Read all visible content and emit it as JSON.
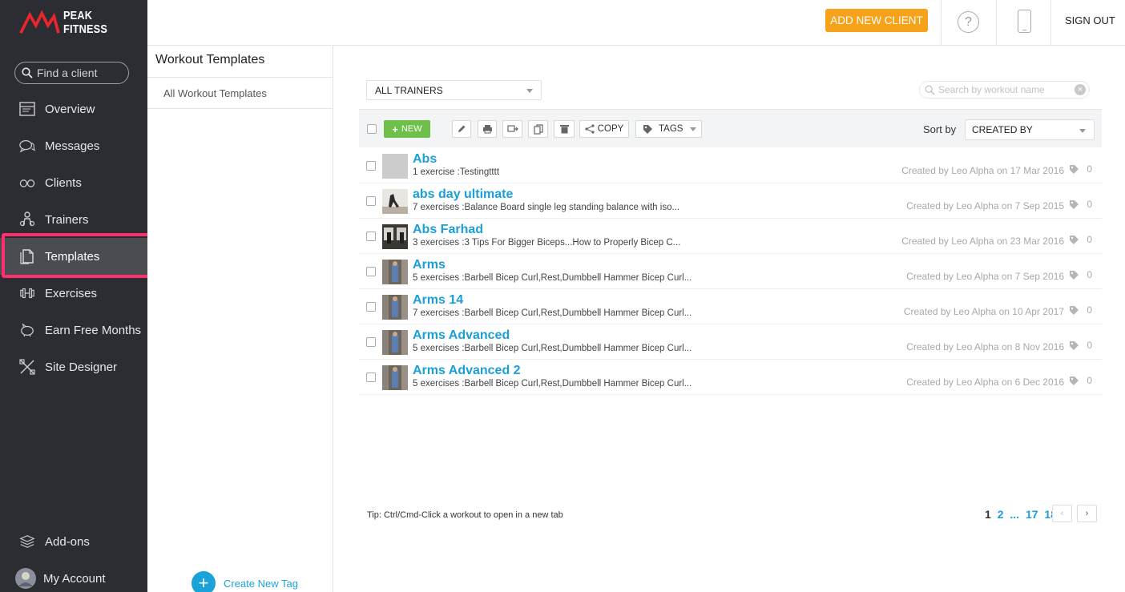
{
  "brand": {
    "name": "PEAK FITNESS",
    "accent": "#f7a21b",
    "link_color": "#1a9fd8"
  },
  "sidebar": {
    "search_placeholder": "Find a client",
    "items": [
      {
        "label": "Overview",
        "icon": "overview-icon"
      },
      {
        "label": "Messages",
        "icon": "messages-icon"
      },
      {
        "label": "Clients",
        "icon": "clients-icon"
      },
      {
        "label": "Trainers",
        "icon": "trainers-icon"
      },
      {
        "label": "Templates",
        "icon": "templates-icon",
        "active": true
      },
      {
        "label": "Exercises",
        "icon": "dumbbell-icon"
      },
      {
        "label": "Earn Free Months",
        "icon": "piggy-bank-icon"
      },
      {
        "label": "Site Designer",
        "icon": "site-designer-icon"
      }
    ],
    "bottom": [
      {
        "label": "Add-ons",
        "icon": "layers-icon"
      },
      {
        "label": "My Account",
        "icon": "avatar"
      }
    ]
  },
  "panel": {
    "title": "Workout Templates",
    "item": "All Workout Templates",
    "create_tag": "Create New Tag"
  },
  "topbar": {
    "add_client": "ADD NEW CLIENT",
    "help": "?",
    "sign_out": "SIGN OUT"
  },
  "filters": {
    "trainer": "ALL TRAINERS",
    "search_placeholder": "Search by workout name"
  },
  "toolbar": {
    "new": "NEW",
    "copy": "COPY",
    "tags": "TAGS",
    "sort_label": "Sort by",
    "sort_value": "CREATED BY"
  },
  "workouts": [
    {
      "title": "Abs",
      "desc": "1 exercise :Testingtttt",
      "meta": "Created by Leo Alpha on 17 Mar 2016",
      "tags": "0"
    },
    {
      "title": "abs day ultimate",
      "desc": "7 exercises :Balance Board single leg standing balance with iso...",
      "meta": "Created by Leo Alpha on 7 Sep 2015",
      "tags": "0"
    },
    {
      "title": "Abs Farhad",
      "desc": "3 exercises :3 Tips For Bigger Biceps...How to Properly Bicep C...",
      "meta": "Created by Leo Alpha on 23 Mar 2016",
      "tags": "0"
    },
    {
      "title": "Arms",
      "desc": "5 exercises :Barbell Bicep Curl,Rest,Dumbbell Hammer Bicep Curl...",
      "meta": "Created by Leo Alpha on 7 Sep 2016",
      "tags": "0"
    },
    {
      "title": "Arms 14",
      "desc": "7 exercises :Barbell Bicep Curl,Rest,Dumbbell Hammer Bicep Curl...",
      "meta": "Created by Leo Alpha on 10 Apr 2017",
      "tags": "0"
    },
    {
      "title": "Arms Advanced",
      "desc": "5 exercises :Barbell Bicep Curl,Rest,Dumbbell Hammer Bicep Curl...",
      "meta": "Created by Leo Alpha on 8 Nov 2016",
      "tags": "0"
    },
    {
      "title": "Arms Advanced 2",
      "desc": "5 exercises :Barbell Bicep Curl,Rest,Dumbbell Hammer Bicep Curl...",
      "meta": "Created by Leo Alpha on 6 Dec 2016",
      "tags": "0"
    }
  ],
  "footer": {
    "tip": "Tip: Ctrl/Cmd-Click a workout to open in a new tab",
    "pages": [
      "1",
      "2",
      "...",
      "17",
      "18"
    ],
    "current_page": "1"
  }
}
